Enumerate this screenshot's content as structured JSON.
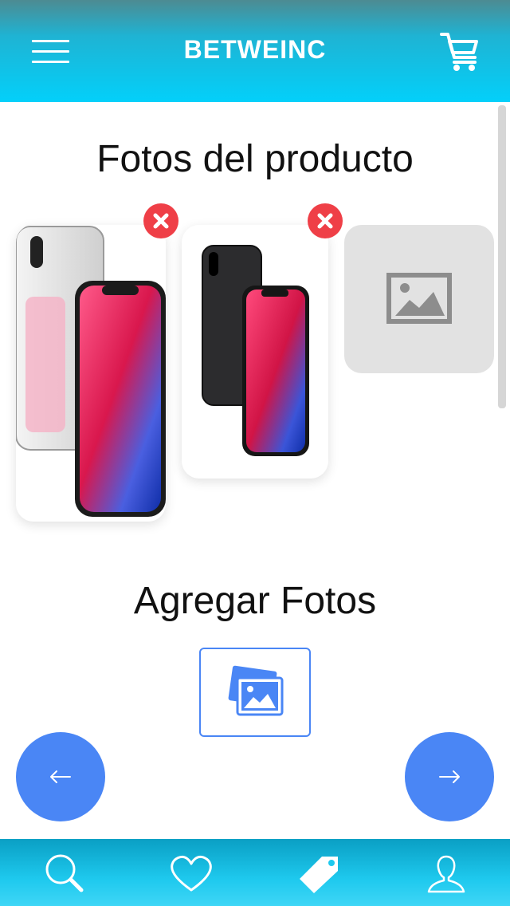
{
  "header": {
    "title": "BETWEINC",
    "menu_icon": "hamburger-menu-icon",
    "cart_icon": "shopping-cart-icon"
  },
  "product_photos": {
    "title": "Fotos del producto",
    "photos": [
      {
        "subject": "iPhone X silver, front and back",
        "remove_icon": "close-icon"
      },
      {
        "subject": "iPhone X space gray, front and back",
        "remove_icon": "close-icon"
      }
    ],
    "placeholder_icon": "image-placeholder-icon"
  },
  "add_photos": {
    "title": "Agregar Fotos",
    "icon": "photo-gallery-icon"
  },
  "navigation": {
    "prev_label": "←",
    "next_label": "→"
  },
  "bottom_tabs": [
    {
      "icon": "search-icon",
      "active": false
    },
    {
      "icon": "heart-icon",
      "active": false
    },
    {
      "icon": "tag-icon",
      "active": true
    },
    {
      "icon": "user-icon",
      "active": false
    }
  ],
  "colors": {
    "accent": "#4a86f5",
    "remove": "#ef3f47",
    "header_top": "#4d8b92",
    "header_bottom": "#03d0fa"
  }
}
